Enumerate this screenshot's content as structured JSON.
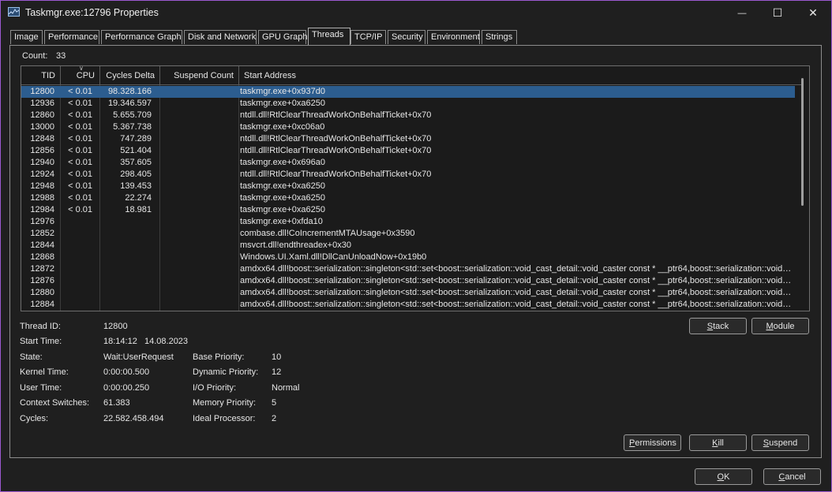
{
  "window": {
    "title": "Taskmgr.exe:12796 Properties",
    "accent_border": "#9b59d0",
    "minimize_glyph": "—",
    "maximize_glyph": "☐",
    "close_glyph": "✕"
  },
  "tabs": [
    {
      "label": "Image"
    },
    {
      "label": "Performance"
    },
    {
      "label": "Performance Graph"
    },
    {
      "label": "Disk and Network"
    },
    {
      "label": "GPU Graph"
    },
    {
      "label": "Threads"
    },
    {
      "label": "TCP/IP"
    },
    {
      "label": "Security"
    },
    {
      "label": "Environment"
    },
    {
      "label": "Strings"
    }
  ],
  "active_tab": "Threads",
  "count": {
    "label": "Count:",
    "value": "33"
  },
  "columns": {
    "tid": "TID",
    "cpu": "CPU",
    "cycles": "Cycles Delta",
    "suspend": "Suspend Count",
    "address": "Start Address"
  },
  "threads": [
    {
      "tid": "12800",
      "cpu": "< 0.01",
      "cycles": "98.328.166",
      "address": "taskmgr.exe+0x937d0"
    },
    {
      "tid": "12936",
      "cpu": "< 0.01",
      "cycles": "19.346.597",
      "address": "taskmgr.exe+0xa6250"
    },
    {
      "tid": "12860",
      "cpu": "< 0.01",
      "cycles": "5.655.709",
      "address": "ntdll.dll!RtlClearThreadWorkOnBehalfTicket+0x70"
    },
    {
      "tid": "13000",
      "cpu": "< 0.01",
      "cycles": "5.367.738",
      "address": "taskmgr.exe+0xc06a0"
    },
    {
      "tid": "12848",
      "cpu": "< 0.01",
      "cycles": "747.289",
      "address": "ntdll.dll!RtlClearThreadWorkOnBehalfTicket+0x70"
    },
    {
      "tid": "12856",
      "cpu": "< 0.01",
      "cycles": "521.404",
      "address": "ntdll.dll!RtlClearThreadWorkOnBehalfTicket+0x70"
    },
    {
      "tid": "12940",
      "cpu": "< 0.01",
      "cycles": "357.605",
      "address": "taskmgr.exe+0x696a0"
    },
    {
      "tid": "12924",
      "cpu": "< 0.01",
      "cycles": "298.405",
      "address": "ntdll.dll!RtlClearThreadWorkOnBehalfTicket+0x70"
    },
    {
      "tid": "12948",
      "cpu": "< 0.01",
      "cycles": "139.453",
      "address": "taskmgr.exe+0xa6250"
    },
    {
      "tid": "12988",
      "cpu": "< 0.01",
      "cycles": "22.274",
      "address": "taskmgr.exe+0xa6250"
    },
    {
      "tid": "12984",
      "cpu": "< 0.01",
      "cycles": "18.981",
      "address": "taskmgr.exe+0xa6250"
    },
    {
      "tid": "12976",
      "cpu": "",
      "cycles": "",
      "address": "taskmgr.exe+0xfda10"
    },
    {
      "tid": "12852",
      "cpu": "",
      "cycles": "",
      "address": "combase.dll!CoIncrementMTAUsage+0x3590"
    },
    {
      "tid": "12844",
      "cpu": "",
      "cycles": "",
      "address": "msvcrt.dll!endthreadex+0x30"
    },
    {
      "tid": "12868",
      "cpu": "",
      "cycles": "",
      "address": "Windows.UI.Xaml.dll!DllCanUnloadNow+0x19b0"
    },
    {
      "tid": "12872",
      "cpu": "",
      "cycles": "",
      "address": "amdxx64.dll!boost::serialization::singleton<std::set<boost::serialization::void_cast_detail::void_caster const * __ptr64,boost::serialization::void_cast..."
    },
    {
      "tid": "12876",
      "cpu": "",
      "cycles": "",
      "address": "amdxx64.dll!boost::serialization::singleton<std::set<boost::serialization::void_cast_detail::void_caster const * __ptr64,boost::serialization::void_cast..."
    },
    {
      "tid": "12880",
      "cpu": "",
      "cycles": "",
      "address": "amdxx64.dll!boost::serialization::singleton<std::set<boost::serialization::void_cast_detail::void_caster const * __ptr64,boost::serialization::void_cast..."
    },
    {
      "tid": "12884",
      "cpu": "",
      "cycles": "",
      "address": "amdxx64.dll!boost::serialization::singleton<std::set<boost::serialization::void_cast_detail::void_caster const * __ptr64,boost::serialization::void_cast..."
    }
  ],
  "selected_tid": "12800",
  "selection_color": "#2c5d8f",
  "details": {
    "thread_id": {
      "label": "Thread ID:",
      "value": "12800"
    },
    "start_time": {
      "label": "Start Time:",
      "value": "18:14:12   14.08.2023"
    },
    "state": {
      "label": "State:",
      "value": "Wait:UserRequest"
    },
    "kernel_time": {
      "label": "Kernel Time:",
      "value": "0:00:00.500"
    },
    "user_time": {
      "label": "User Time:",
      "value": "0:00:00.250"
    },
    "context_switches": {
      "label": "Context Switches:",
      "value": "61.383"
    },
    "cycles": {
      "label": "Cycles:",
      "value": "22.582.458.494"
    },
    "base_priority": {
      "label": "Base Priority:",
      "value": "10"
    },
    "dynamic_priority": {
      "label": "Dynamic Priority:",
      "value": "12"
    },
    "io_priority": {
      "label": "I/O Priority:",
      "value": "Normal"
    },
    "memory_priority": {
      "label": "Memory Priority:",
      "value": "5"
    },
    "ideal_processor": {
      "label": "Ideal Processor:",
      "value": "2"
    }
  },
  "buttons": {
    "stack": {
      "mnemonic": "S",
      "rest": "tack"
    },
    "module": {
      "mnemonic": "M",
      "rest": "odule"
    },
    "permissions": {
      "mnemonic": "P",
      "rest": "ermissions"
    },
    "kill": {
      "mnemonic": "K",
      "rest": "ill"
    },
    "suspend": {
      "mnemonic": "S",
      "rest": "uspend"
    },
    "ok": {
      "mnemonic": "O",
      "rest": "K"
    },
    "cancel": {
      "mnemonic": "C",
      "rest": "ancel"
    }
  }
}
